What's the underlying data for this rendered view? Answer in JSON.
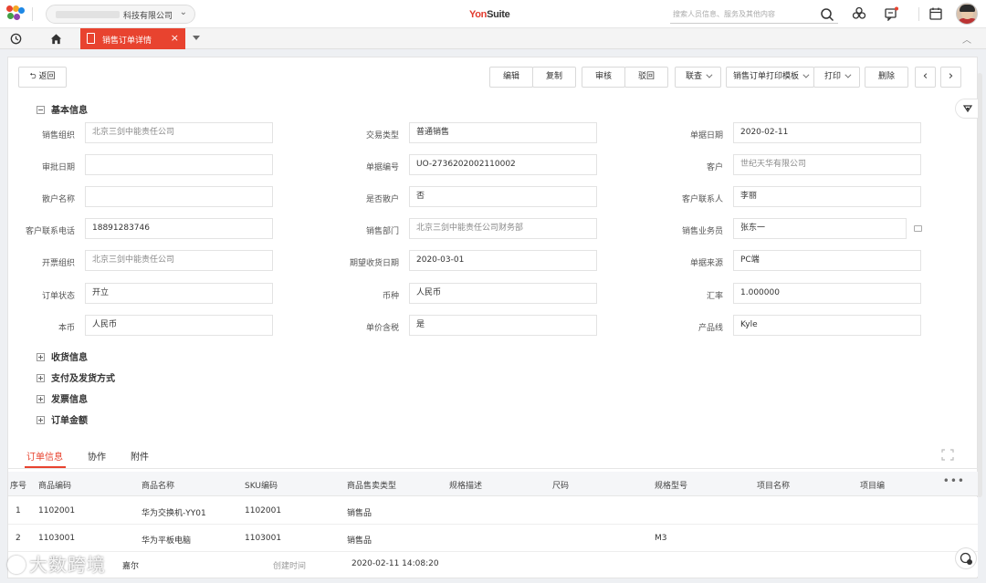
{
  "header": {
    "org_name": "科技有限公司",
    "brand": "YonSuite",
    "search_placeholder": "搜索人员信息、服务及其他内容"
  },
  "tabs": {
    "active_label": "销售订单详情",
    "close": "×"
  },
  "toolbar": {
    "back": "返回",
    "edit": "编辑",
    "copy": "复制",
    "audit": "审核",
    "reject": "驳回",
    "linked_query": "联查",
    "print_template": "销售订单打印模板",
    "print": "打印",
    "delete": "删除",
    "prev": "‹",
    "next": "›"
  },
  "sections": {
    "basic": "基本信息",
    "receive": "收货信息",
    "payment": "支付及发货方式",
    "invoice": "发票信息",
    "amount": "订单金额"
  },
  "fields": [
    {
      "label": "销售组织",
      "value": "北京三剑中能责任公司"
    },
    {
      "label": "交易类型",
      "value": "普通销售"
    },
    {
      "label": "单据日期",
      "value": "2020-02-11"
    },
    {
      "label": "审批日期",
      "value": ""
    },
    {
      "label": "单据编号",
      "value": "UO-2736202002110002"
    },
    {
      "label": "客户",
      "value": "世纪天华有限公司"
    },
    {
      "label": "散户名称",
      "value": ""
    },
    {
      "label": "是否散户",
      "value": "否"
    },
    {
      "label": "客户联系人",
      "value": "李丽"
    },
    {
      "label": "客户联系电话",
      "value": "18891283746"
    },
    {
      "label": "销售部门",
      "value": "北京三剑中能责任公司财务部"
    },
    {
      "label": "销售业务员",
      "value": "张东一"
    },
    {
      "label": "开票组织",
      "value": "北京三剑中能责任公司"
    },
    {
      "label": "期望收货日期",
      "value": "2020-03-01"
    },
    {
      "label": "单据来源",
      "value": "PC端"
    },
    {
      "label": "订单状态",
      "value": "开立"
    },
    {
      "label": "币种",
      "value": "人民币"
    },
    {
      "label": "汇率",
      "value": "1.000000"
    },
    {
      "label": "本币",
      "value": "人民币"
    },
    {
      "label": "单价含税",
      "value": "是"
    },
    {
      "label": "产品线",
      "value": "Kyle"
    }
  ],
  "lower_tabs": {
    "order_info": "订单信息",
    "collab": "协作",
    "attach": "附件"
  },
  "table": {
    "columns": [
      "序号",
      "商品编码",
      "商品名称",
      "SKU编码",
      "商品售卖类型",
      "规格描述",
      "尺码",
      "规格型号",
      "项目名称",
      "项目编"
    ],
    "more": "•••",
    "rows": [
      [
        "1",
        "1102001",
        "华为交换机-YY01",
        "1102001",
        "销售品",
        "",
        "",
        "",
        "",
        ""
      ],
      [
        "2",
        "1103001",
        "华为平板电脑",
        "1103001",
        "销售品",
        "",
        "",
        "M3",
        "",
        ""
      ]
    ]
  },
  "footer": {
    "creator": "嘉尔",
    "created_label": "创建时间",
    "created_value": "2020-02-11 14:08:20",
    "watermark": "大数跨境"
  }
}
